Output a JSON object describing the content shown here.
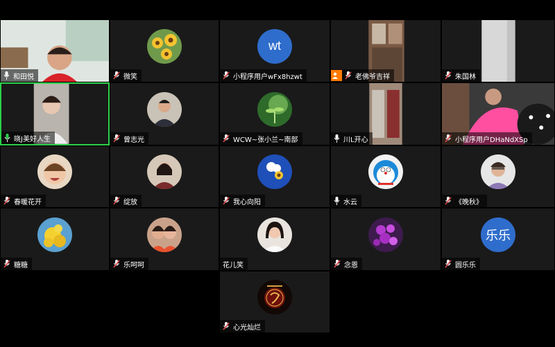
{
  "colors": {
    "tile_bg": "#1a1a1a",
    "active_border": "#2bd14a",
    "muted_mic": "#e04a4a",
    "host_badge": "#ff7a00",
    "avatar_blue": "#2f6dcc"
  },
  "participants": [
    {
      "name": "和田悦",
      "mic": "on",
      "kind": "video"
    },
    {
      "name": "微笑",
      "mic": "muted",
      "kind": "avatar"
    },
    {
      "name": "小程序用户wFx8hzwt",
      "mic": "muted",
      "kind": "initials",
      "initials": "wt"
    },
    {
      "name": "老佛爷吉祥",
      "mic": "muted",
      "kind": "video",
      "host": true
    },
    {
      "name": "朱国林",
      "mic": "muted",
      "kind": "video"
    },
    {
      "name": "晓J美好人生",
      "mic": "on",
      "kind": "video",
      "active": true
    },
    {
      "name": "曾志光",
      "mic": "muted",
      "kind": "avatar"
    },
    {
      "name": "WCW~张小兰~南部",
      "mic": "muted",
      "kind": "avatar"
    },
    {
      "name": "川L开心",
      "mic": "on",
      "kind": "video"
    },
    {
      "name": "小程序用户DHaNdXSp",
      "mic": "muted",
      "kind": "video"
    },
    {
      "name": "春暖花开",
      "mic": "muted",
      "kind": "avatar"
    },
    {
      "name": "绽放",
      "mic": "muted",
      "kind": "avatar"
    },
    {
      "name": "我心向阳",
      "mic": "muted",
      "kind": "avatar"
    },
    {
      "name": "水云",
      "mic": "on",
      "kind": "avatar"
    },
    {
      "name": "《晚秋》",
      "mic": "muted",
      "kind": "avatar"
    },
    {
      "name": "糖糖",
      "mic": "muted",
      "kind": "avatar"
    },
    {
      "name": "乐呵呵",
      "mic": "muted",
      "kind": "avatar"
    },
    {
      "name": "花儿笑",
      "mic": "none",
      "kind": "avatar"
    },
    {
      "name": "念恩",
      "mic": "muted",
      "kind": "avatar"
    },
    {
      "name": "圆乐乐",
      "mic": "muted",
      "kind": "initials",
      "initials": "乐乐"
    },
    {
      "name": "心光灿烂",
      "mic": "muted",
      "kind": "avatar"
    }
  ]
}
